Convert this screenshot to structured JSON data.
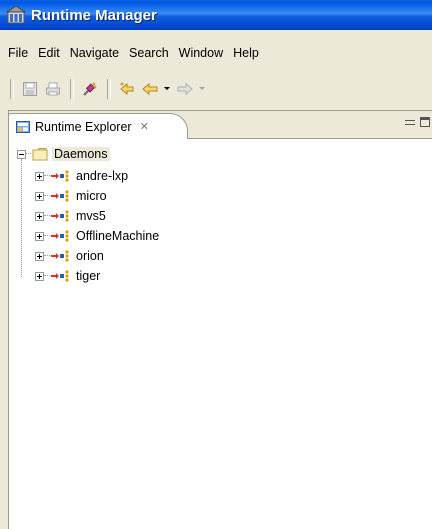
{
  "window": {
    "title": "Runtime Manager"
  },
  "menubar": {
    "items": [
      "File",
      "Edit",
      "Navigate",
      "Search",
      "Window",
      "Help"
    ]
  },
  "toolbar": {
    "icons": [
      "save-icon",
      "print-icon",
      "connect-icon",
      "back-history-icon",
      "back-icon",
      "forward-icon"
    ]
  },
  "view": {
    "tab_label": "Runtime Explorer",
    "close_glyph": "✕"
  },
  "tree": {
    "root": {
      "label": "Daemons",
      "expanded": true
    },
    "children": [
      {
        "label": "andre-lxp"
      },
      {
        "label": "micro"
      },
      {
        "label": "mvs5"
      },
      {
        "label": "OfflineMachine"
      },
      {
        "label": "orion"
      },
      {
        "label": "tiger"
      }
    ]
  },
  "colors": {
    "titlebar": "#0058e6",
    "chrome": "#ece9d8",
    "selection_bg": "#ece9d8"
  }
}
